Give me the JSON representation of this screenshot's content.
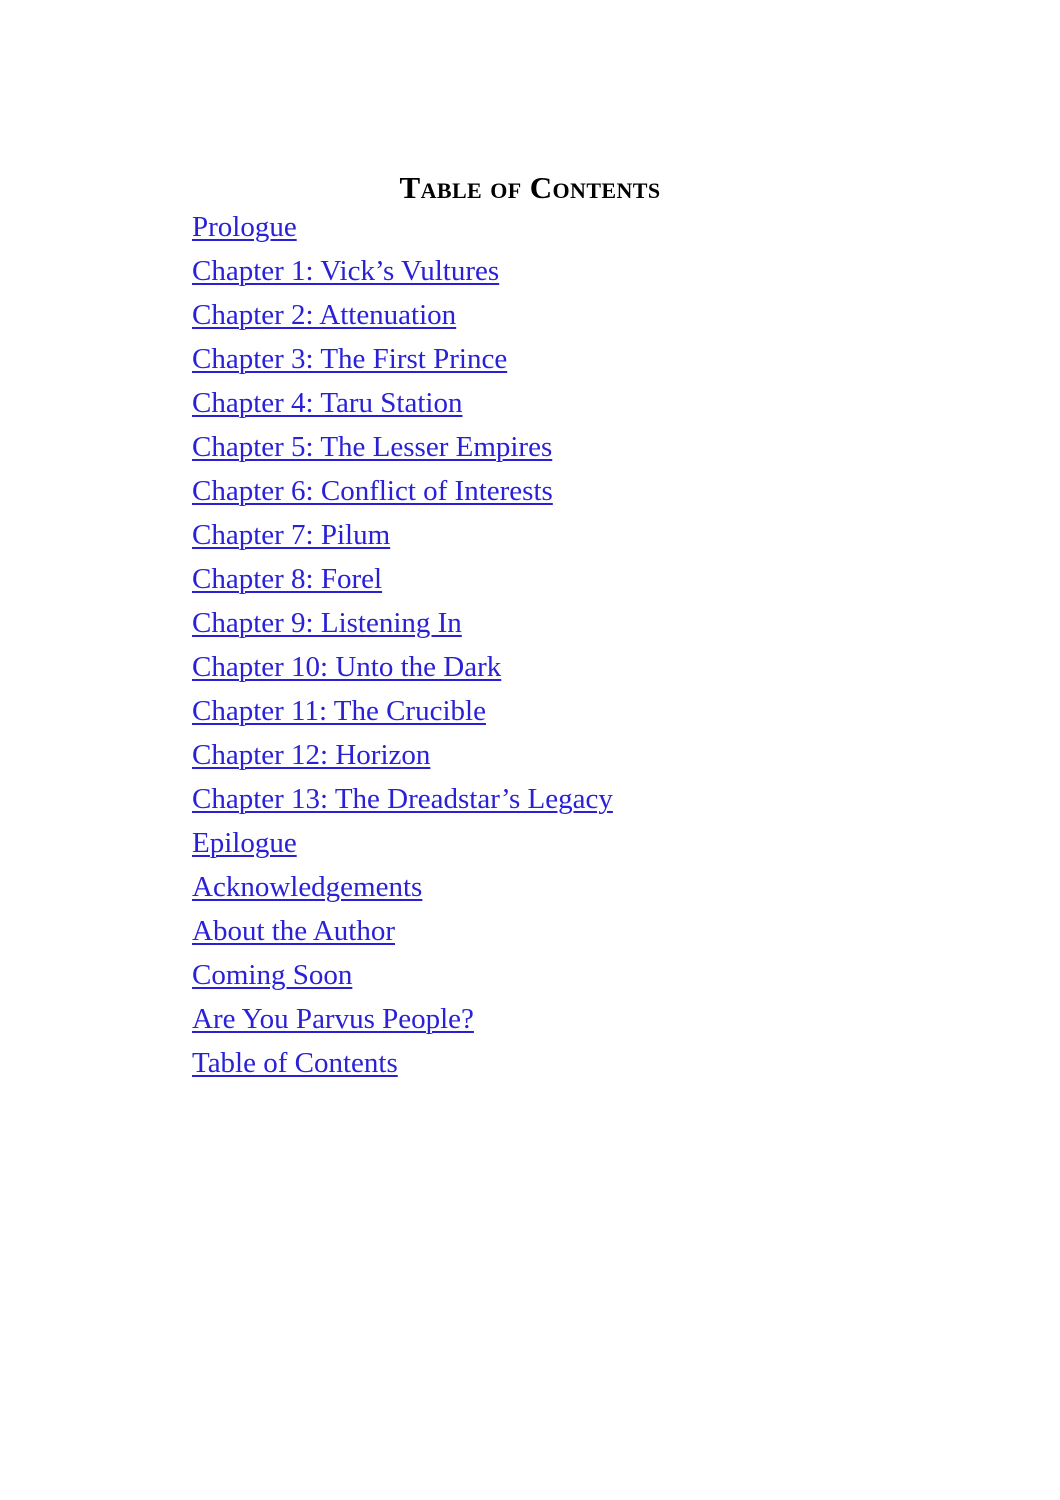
{
  "page": {
    "background_color": "#ffffff",
    "heading_color": "#000000",
    "link_color": "#2a21d6"
  },
  "heading": {
    "text": "Table of Contents"
  },
  "toc": {
    "entries": [
      {
        "label": "Prologue"
      },
      {
        "label": "Chapter 1: Vick’s Vultures"
      },
      {
        "label": "Chapter 2: Attenuation"
      },
      {
        "label": "Chapter 3: The First Prince"
      },
      {
        "label": "Chapter 4: Taru Station"
      },
      {
        "label": "Chapter 5: The Lesser Empires"
      },
      {
        "label": "Chapter 6: Conflict of Interests"
      },
      {
        "label": "Chapter 7: Pilum"
      },
      {
        "label": "Chapter 8: Forel"
      },
      {
        "label": "Chapter 9: Listening In"
      },
      {
        "label": "Chapter 10: Unto the Dark"
      },
      {
        "label": "Chapter 11: The Crucible"
      },
      {
        "label": "Chapter 12: Horizon"
      },
      {
        "label": "Chapter 13: The Dreadstar’s Legacy"
      },
      {
        "label": "Epilogue"
      },
      {
        "label": "Acknowledgements"
      },
      {
        "label": "About the Author"
      },
      {
        "label": "Coming Soon"
      },
      {
        "label": "Are You Parvus People?"
      },
      {
        "label": "Table of Contents"
      }
    ]
  }
}
